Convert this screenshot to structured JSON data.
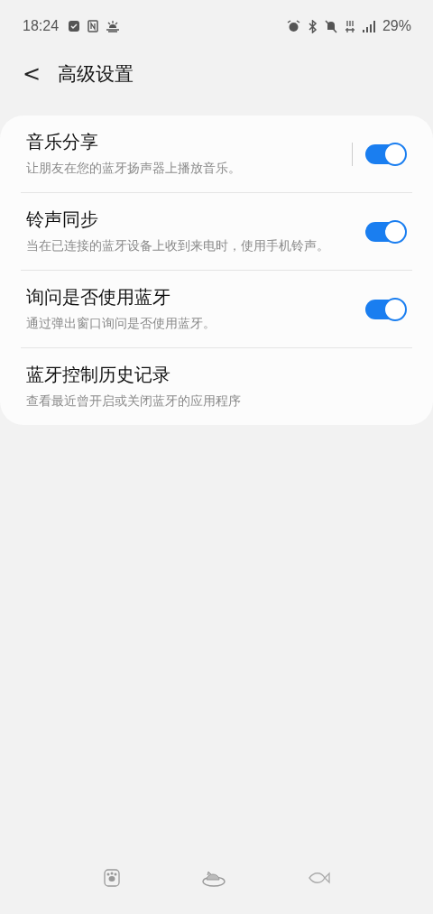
{
  "status_bar": {
    "time": "18:24",
    "battery": "29%"
  },
  "header": {
    "back": "<",
    "title": "高级设置"
  },
  "settings": [
    {
      "kind": "split_switch",
      "title": "音乐分享",
      "subtitle": "让朋友在您的蓝牙扬声器上播放音乐。",
      "on": true
    },
    {
      "kind": "switch",
      "title": "铃声同步",
      "subtitle": "当在已连接的蓝牙设备上收到来电时，使用手机铃声。",
      "on": true
    },
    {
      "kind": "switch",
      "title": "询问是否使用蓝牙",
      "subtitle": "通过弹出窗口询问是否使用蓝牙。",
      "on": true
    },
    {
      "kind": "link",
      "title": "蓝牙控制历史记录",
      "subtitle": "查看最近曾开启或关闭蓝牙的应用程序"
    }
  ]
}
